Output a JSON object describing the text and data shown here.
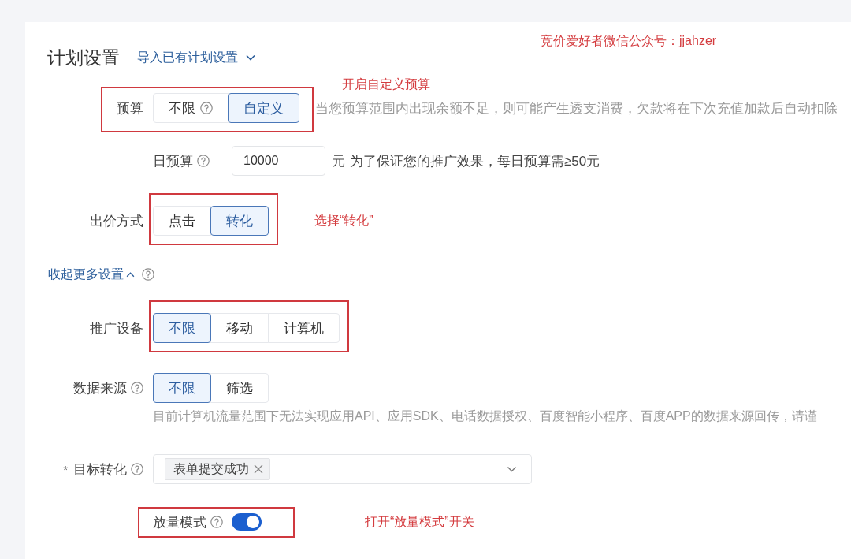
{
  "note": "竞价爱好者微信公众号：jjahzer",
  "header": {
    "title": "计划设置",
    "import_link": "导入已有计划设置"
  },
  "fields": [
    {
      "kind": "segmented",
      "label": "预算",
      "highlighted": true,
      "highlight_includes_label": true,
      "annotation": "开启自定义预算",
      "options": [
        {
          "label": "不限",
          "help": true,
          "selected": false
        },
        {
          "label": "自定义",
          "selected": true
        }
      ],
      "hint": "当您预算范围内出现余额不足，则可能产生透支消费，欠款将在下次充值加款后自动扣除",
      "children": [
        {
          "kind": "input",
          "label": "日预算",
          "help": true,
          "value": "10000",
          "unit": "元",
          "hint": "为了保证您的推广效果，每日预算需≥50元"
        }
      ]
    },
    {
      "kind": "segmented",
      "label": "出价方式",
      "highlighted": true,
      "highlight_includes_label": false,
      "annotation": "选择“转化”",
      "options": [
        {
          "label": "点击",
          "selected": false
        },
        {
          "label": "转化",
          "selected": true
        }
      ]
    },
    {
      "kind": "toggle-link",
      "label": "收起更多设置",
      "help": true,
      "expanded": true
    },
    {
      "kind": "segmented",
      "label": "推广设备",
      "highlighted": true,
      "highlight_includes_label": false,
      "options": [
        {
          "label": "不限",
          "selected": true
        },
        {
          "label": "移动",
          "selected": false
        },
        {
          "label": "计算机",
          "selected": false
        }
      ]
    },
    {
      "kind": "segmented",
      "label": "数据来源",
      "help": true,
      "options": [
        {
          "label": "不限",
          "selected": true
        },
        {
          "label": "筛选",
          "selected": false
        }
      ],
      "description": "目前计算机流量范围下无法实现应用API、应用SDK、电话数据授权、百度智能小程序、百度APP的数据来源回传，请谨"
    },
    {
      "kind": "select",
      "label": "目标转化",
      "required_mark": "*",
      "help": true,
      "tags": [
        {
          "label": "表单提交成功"
        }
      ],
      "children": [
        {
          "kind": "switch",
          "label": "放量模式",
          "help": true,
          "on": true,
          "highlighted": true,
          "highlight_includes_label": true,
          "annotation": "打开“放量模式”开关"
        }
      ]
    }
  ]
}
